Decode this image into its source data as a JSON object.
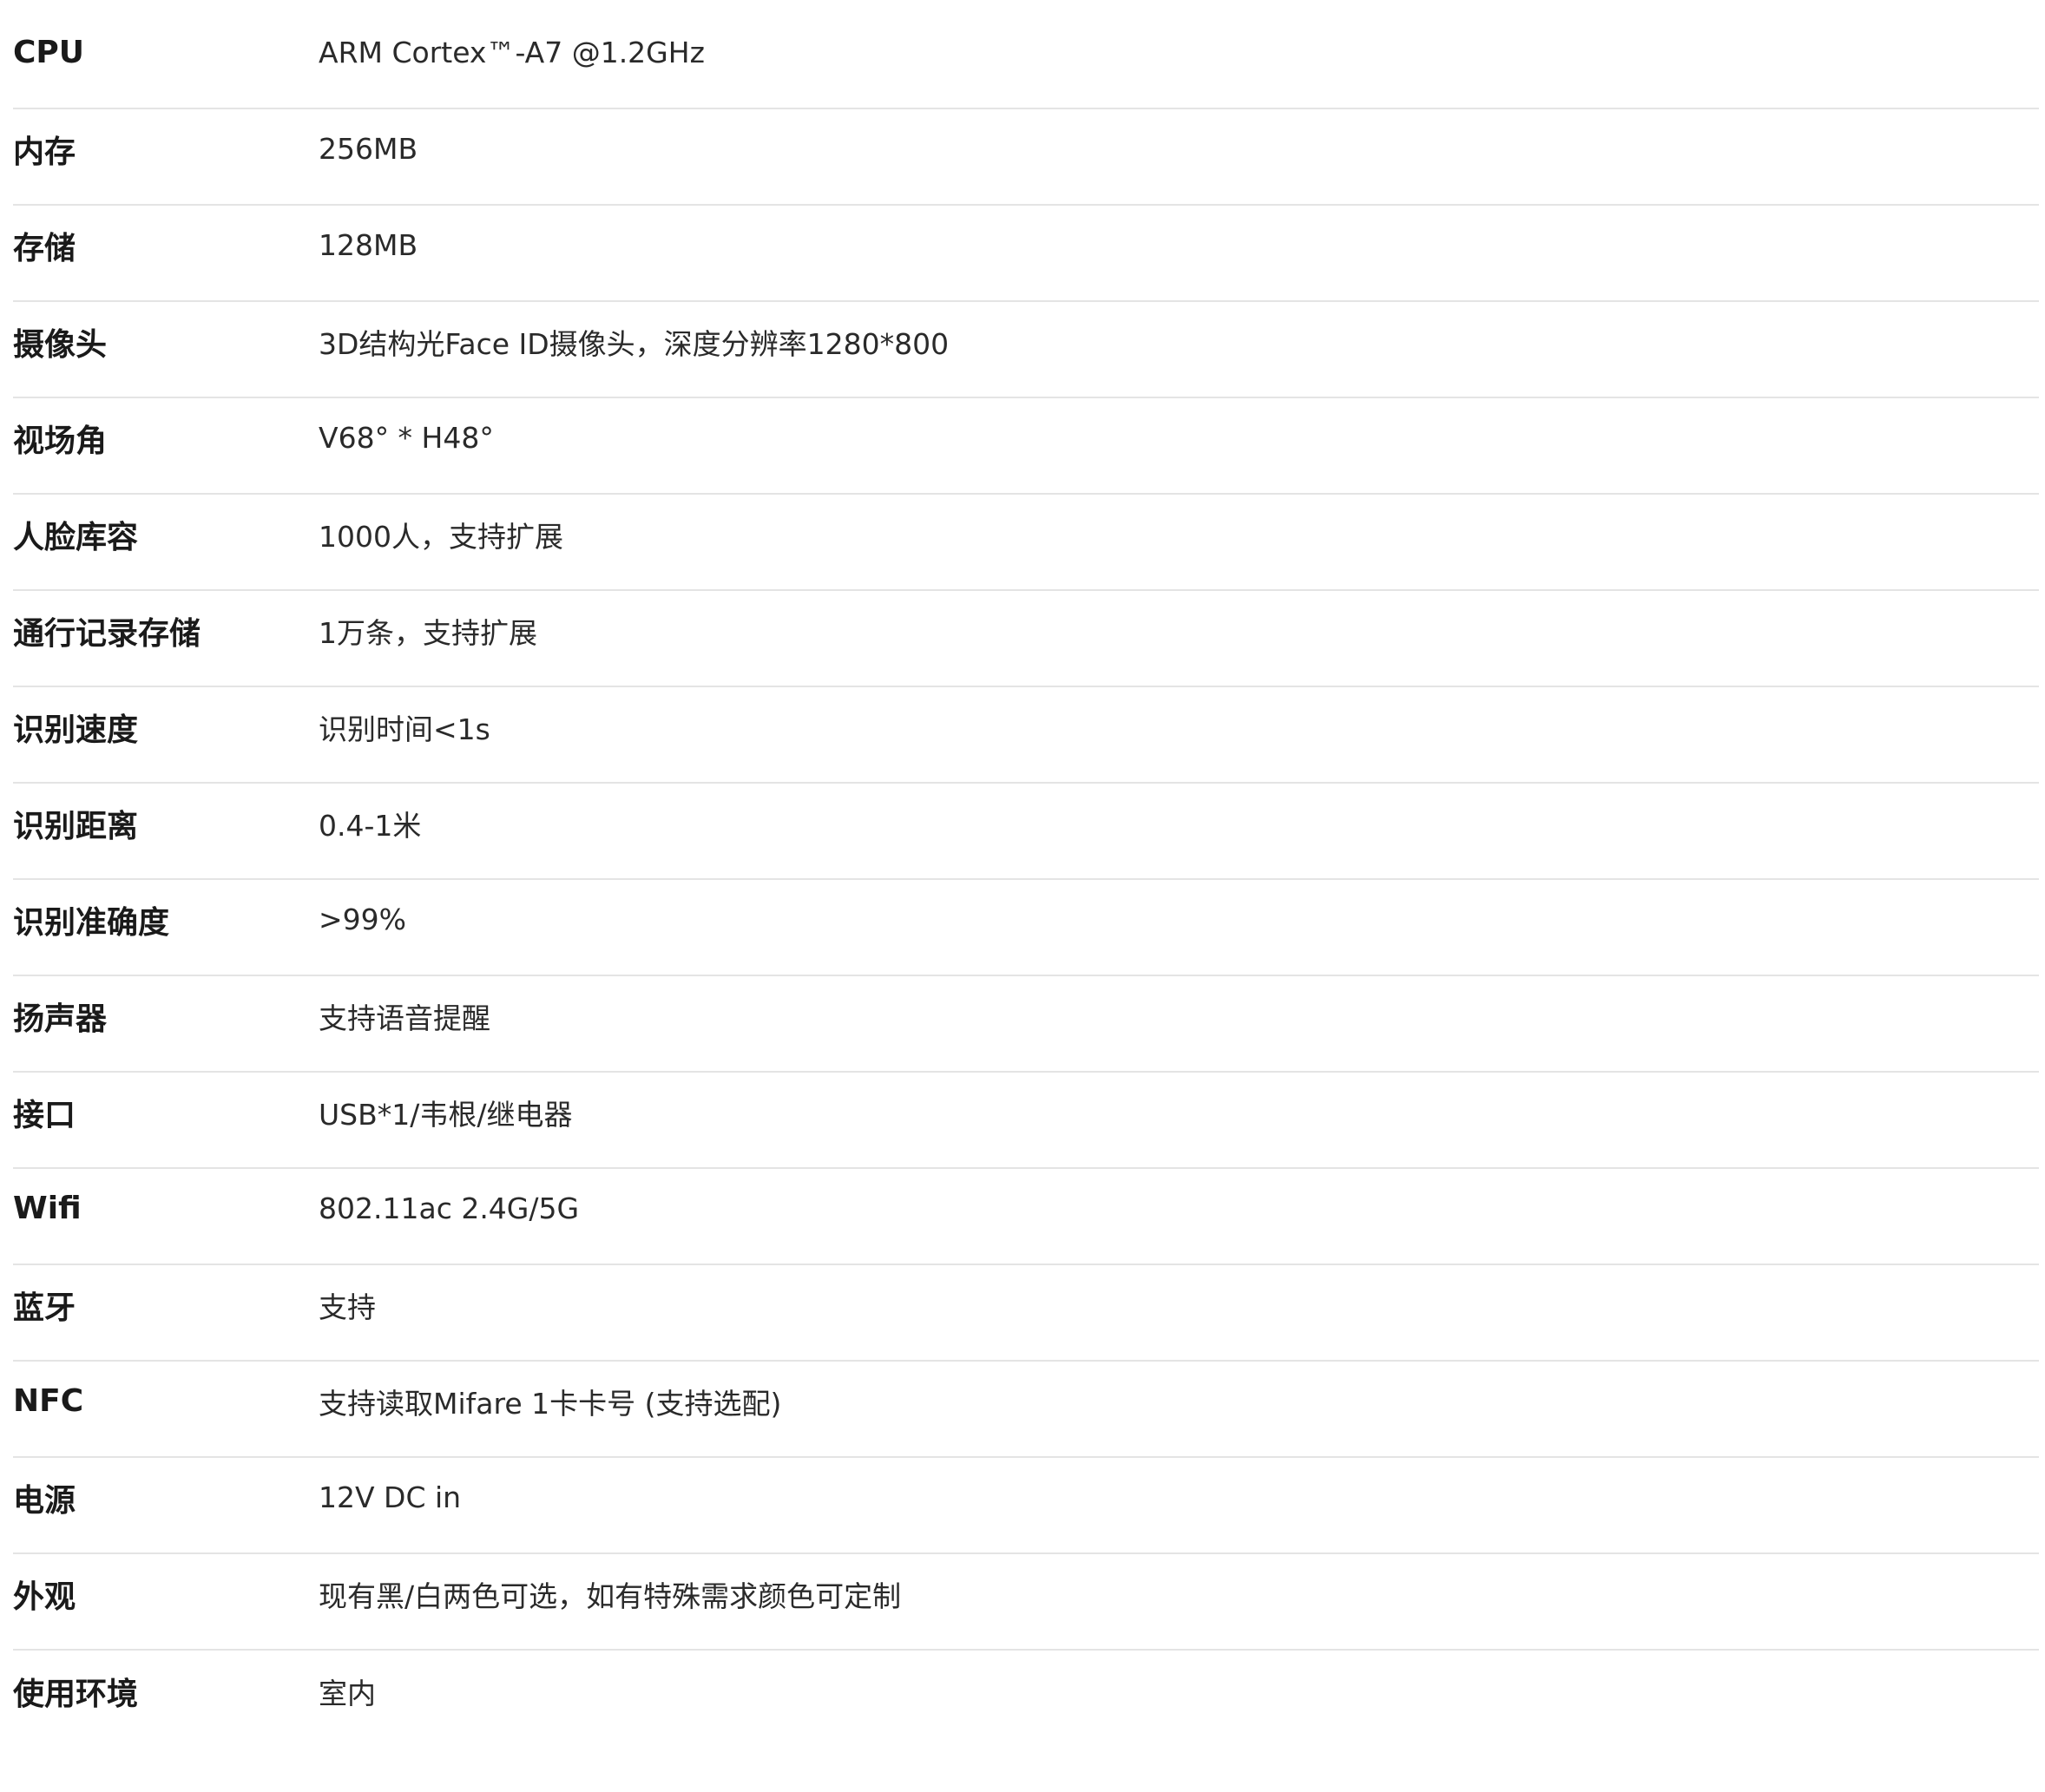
{
  "specs": [
    {
      "label": "CPU",
      "value": "ARM Cortex™-A7 @1.2GHz"
    },
    {
      "label": "内存",
      "value": "256MB"
    },
    {
      "label": "存储",
      "value": "128MB"
    },
    {
      "label": "摄像头",
      "value": "3D结构光Face ID摄像头，深度分辨率1280*800"
    },
    {
      "label": "视场角",
      "value": "V68° * H48°"
    },
    {
      "label": "人脸库容",
      "value": "1000人，支持扩展"
    },
    {
      "label": "通行记录存储",
      "value": "1万条，支持扩展"
    },
    {
      "label": "识别速度",
      "value": "识别时间<1s"
    },
    {
      "label": "识别距离",
      "value": "0.4-1米"
    },
    {
      "label": "识别准确度",
      "value": ">99%"
    },
    {
      "label": "扬声器",
      "value": "支持语音提醒"
    },
    {
      "label": "接口",
      "value": "USB*1/韦根/继电器"
    },
    {
      "label": "Wifi",
      "value": "802.11ac 2.4G/5G"
    },
    {
      "label": "蓝牙",
      "value": "支持"
    },
    {
      "label": "NFC",
      "value": "支持读取Mifare 1卡卡号 (支持选配)"
    },
    {
      "label": "电源",
      "value": "12V DC in"
    },
    {
      "label": "外观",
      "value": "现有黑/白两色可选，如有特殊需求颜色可定制"
    },
    {
      "label": "使用环境",
      "value": "室内"
    }
  ]
}
